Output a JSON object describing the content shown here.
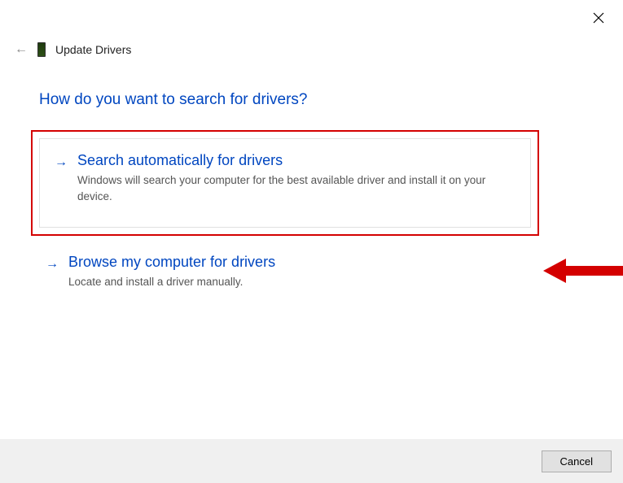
{
  "window": {
    "title": "Update Drivers"
  },
  "page": {
    "heading": "How do you want to search for drivers?"
  },
  "options": {
    "auto": {
      "title": "Search automatically for drivers",
      "description": "Windows will search your computer for the best available driver and install it on your device."
    },
    "browse": {
      "title": "Browse my computer for drivers",
      "description": "Locate and install a driver manually."
    }
  },
  "footer": {
    "cancel_label": "Cancel"
  },
  "annotation": {
    "highlight_color": "#d40000",
    "arrow_color": "#d40000"
  }
}
